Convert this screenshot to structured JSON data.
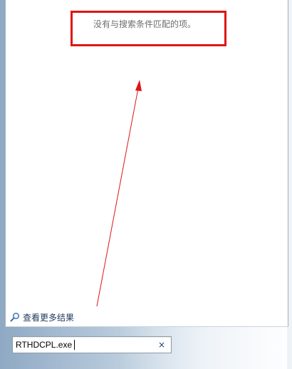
{
  "results": {
    "no_results_text": "没有与搜索条件匹配的项。"
  },
  "see_more": {
    "label": "查看更多结果",
    "icon": "magnifier-icon"
  },
  "search": {
    "value": "RTHDCPL.exe",
    "clear_label": "×"
  },
  "annotation": {
    "highlight_color": "#e01414"
  }
}
